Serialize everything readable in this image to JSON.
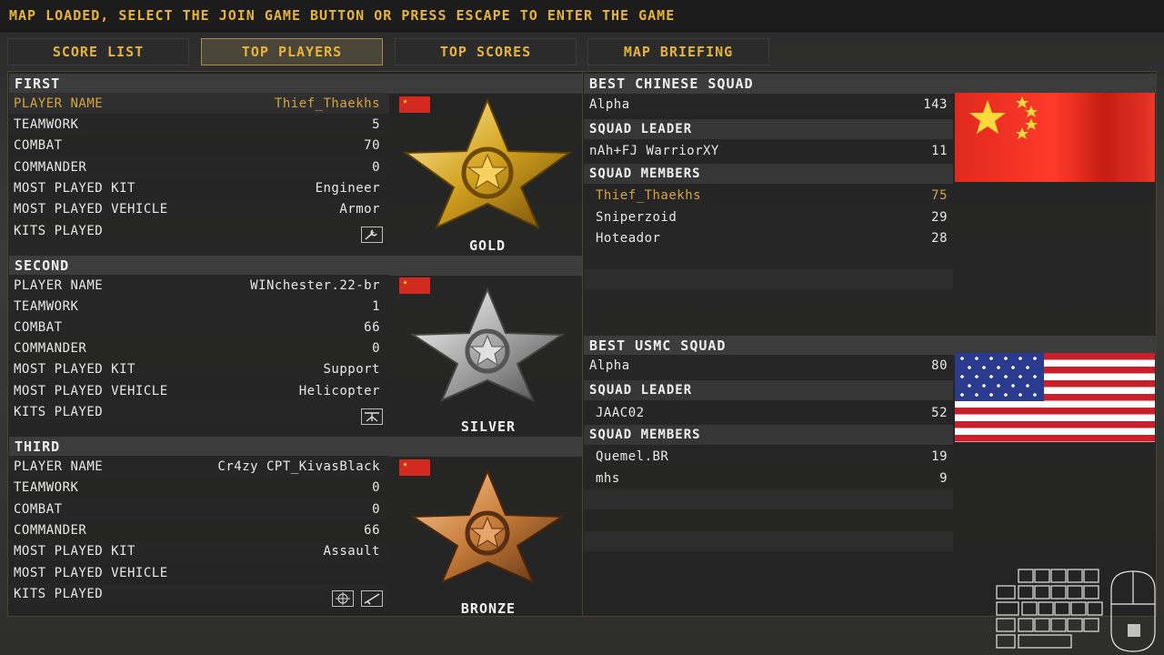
{
  "status_message": "MAP LOADED, SELECT THE JOIN GAME BUTTON OR PRESS ESCAPE TO ENTER THE GAME",
  "tabs": [
    {
      "label": "SCORE LIST"
    },
    {
      "label": "TOP PLAYERS"
    },
    {
      "label": "TOP SCORES"
    },
    {
      "label": "MAP BRIEFING"
    }
  ],
  "active_tab": "TOP PLAYERS",
  "labels": {
    "player_name": "PLAYER NAME",
    "teamwork": "TEAMWORK",
    "combat": "COMBAT",
    "commander": "COMMANDER",
    "most_played_kit": "MOST PLAYED KIT",
    "most_played_vehicle": "MOST PLAYED VEHICLE",
    "kits_played": "KITS PLAYED",
    "squad_leader": "SQUAD LEADER",
    "squad_members": "SQUAD MEMBERS"
  },
  "top_players": [
    {
      "rank": "FIRST",
      "medal": "GOLD",
      "player_name": "Thief_Thaekhs",
      "teamwork": "5",
      "combat": "70",
      "commander": "0",
      "most_played_kit": "Engineer",
      "most_played_vehicle": "Armor",
      "kits_icons": [
        "wrench-icon"
      ]
    },
    {
      "rank": "SECOND",
      "medal": "SILVER",
      "player_name": "WINchester.22-br",
      "teamwork": "1",
      "combat": "66",
      "commander": "0",
      "most_played_kit": "Support",
      "most_played_vehicle": "Helicopter",
      "kits_icons": [
        "ammo-icon"
      ]
    },
    {
      "rank": "THIRD",
      "medal": "BRONZE",
      "player_name": "Cr4zy CPT_KivasBlack",
      "teamwork": "0",
      "combat": "0",
      "commander": "66",
      "most_played_kit": "Assault",
      "most_played_vehicle": "",
      "kits_icons": [
        "crosshair-icon",
        "rifle-icon"
      ]
    }
  ],
  "squads": [
    {
      "title": "BEST CHINESE SQUAD",
      "squad_name": "Alpha",
      "squad_score": "143",
      "leader": {
        "name": "nAh+FJ WarriorXY",
        "score": "11"
      },
      "members": [
        {
          "name": "Thief_Thaekhs",
          "score": "75",
          "highlight": true
        },
        {
          "name": "Sniperzoid",
          "score": "29"
        },
        {
          "name": "Hoteador",
          "score": "28"
        }
      ],
      "flag": "china-flag"
    },
    {
      "title": "BEST USMC SQUAD",
      "squad_name": "Alpha",
      "squad_score": "80",
      "leader": {
        "name": "JAAC02",
        "score": "52"
      },
      "members": [
        {
          "name": "Quemel.BR",
          "score": "19"
        },
        {
          "name": "mhs",
          "score": "9"
        }
      ],
      "flag": "usa-flag"
    }
  ],
  "colors": {
    "accent": "#e6b43a",
    "highlight": "#d9a33a",
    "china_red": "#d22a1e",
    "gold_star": "#ffd93a"
  }
}
